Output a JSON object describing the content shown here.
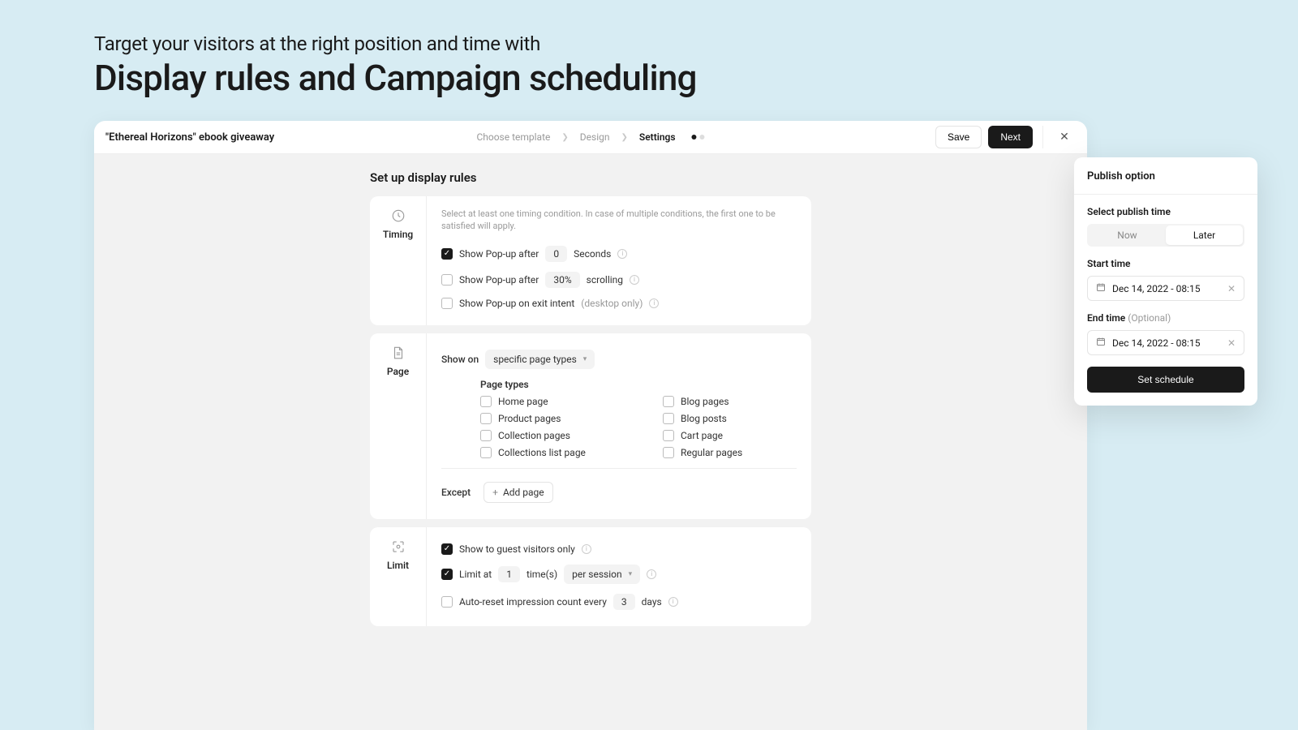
{
  "hero": {
    "subtitle": "Target your visitors at the right position and time with",
    "title": "Display rules and Campaign scheduling"
  },
  "topbar": {
    "doc_title": "\"Ethereal Horizons\" ebook giveaway",
    "crumbs": [
      "Choose template",
      "Design",
      "Settings"
    ],
    "active_crumb": 2,
    "save": "Save",
    "next": "Next"
  },
  "page": {
    "title": "Set up display rules"
  },
  "timing": {
    "label": "Timing",
    "desc": "Select at least one timing condition. In case of multiple conditions, the first one to be satisfied will apply.",
    "after_label": "Show Pop-up after",
    "after_value": "0",
    "after_unit": "Seconds",
    "scroll_label": "Show Pop-up after",
    "scroll_value": "30%",
    "scroll_unit": "scrolling",
    "exit_label": "Show Pop-up on exit intent",
    "exit_hint": "(desktop only)"
  },
  "pageRules": {
    "label": "Page",
    "show_on": "Show on",
    "select": "specific page types",
    "types_heading": "Page types",
    "left": [
      "Home page",
      "Product pages",
      "Collection pages",
      "Collections list page"
    ],
    "right": [
      "Blog pages",
      "Blog posts",
      "Cart page",
      "Regular pages"
    ],
    "except": "Except",
    "add_page": "Add page"
  },
  "limit": {
    "label": "Limit",
    "guest_label": "Show to guest visitors only",
    "limit_at": "Limit at",
    "limit_value": "1",
    "limit_unit": "time(s)",
    "per": "per session",
    "reset_label": "Auto-reset impression count every",
    "reset_value": "3",
    "reset_unit": "days"
  },
  "publish": {
    "title": "Publish option",
    "select_time": "Select publish time",
    "now": "Now",
    "later": "Later",
    "start_label": "Start time",
    "end_label": "End time",
    "optional": "(Optional)",
    "start_value": "Dec 14, 2022 - 08:15",
    "end_value": "Dec 14, 2022 - 08:15",
    "set": "Set schedule"
  }
}
